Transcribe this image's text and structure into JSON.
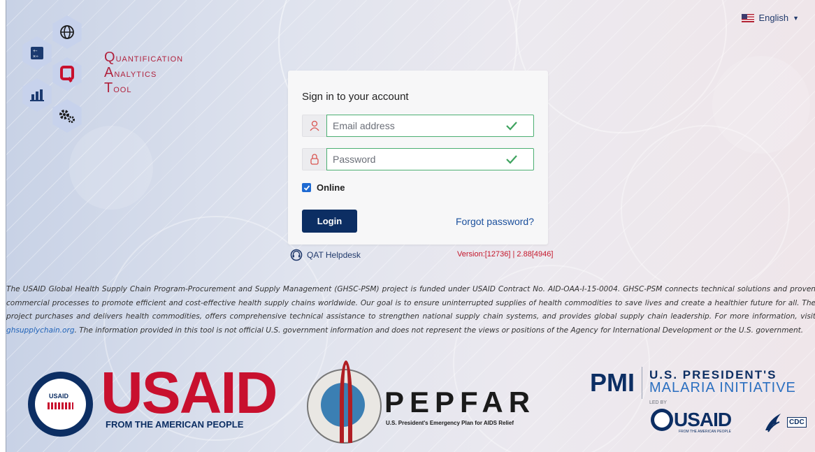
{
  "language": {
    "label": "English",
    "icon": "us-flag-icon"
  },
  "logo": {
    "lines": [
      "Quantification",
      "Analytics",
      "Tool"
    ],
    "brand_color": "#b0223d"
  },
  "login": {
    "title": "Sign in to your account",
    "email_placeholder": "Email address",
    "password_placeholder": "Password",
    "online_label": "Online",
    "online_checked": true,
    "login_button": "Login",
    "forgot_password": "Forgot password?"
  },
  "helpdesk": "QAT Helpdesk",
  "version": "Version:[12736] | 2.88[4946]",
  "disclaimer": {
    "before_link": "The USAID Global Health Supply Chain Program-Procurement and Supply Management (GHSC-PSM) project is funded under USAID Contract No. AID-OAA-I-15-0004. GHSC-PSM connects technical solutions and proven commercial processes to promote efficient and cost-effective health supply chains worldwide. Our goal is to ensure uninterrupted supplies of health commodities to save lives and create a healthier future for all. The project purchases and delivers health commodities, offers comprehensive technical assistance to strengthen national supply chain systems, and provides global supply chain leadership. For more information, visit ",
    "link": "ghsupplychain.org",
    "after_link": ". The information provided in this tool is not official U.S. government information and does not represent the views or positions of the Agency for International Development or the U.S. government."
  },
  "footer": {
    "usaid": {
      "word": "USAID",
      "tagline": "FROM THE AMERICAN PEOPLE",
      "seal_text": "USAID"
    },
    "pepfar": {
      "word": "PEPFAR",
      "tagline": "U.S. President's Emergency Plan for AIDS Relief"
    },
    "pmi": {
      "word": "PMI",
      "line1": "U.S. PRESIDENT'S",
      "line2": "MALARIA INITIATIVE",
      "led_by": "LED BY",
      "small_usaid": "USAID",
      "small_tag": "FROM THE AMERICAN PEOPLE",
      "cdc": "CDC"
    }
  },
  "colors": {
    "primary_button": "#0c2e63",
    "valid_border": "#4caf72",
    "version_text": "#c4162a",
    "usaid_red": "#c8102e"
  }
}
